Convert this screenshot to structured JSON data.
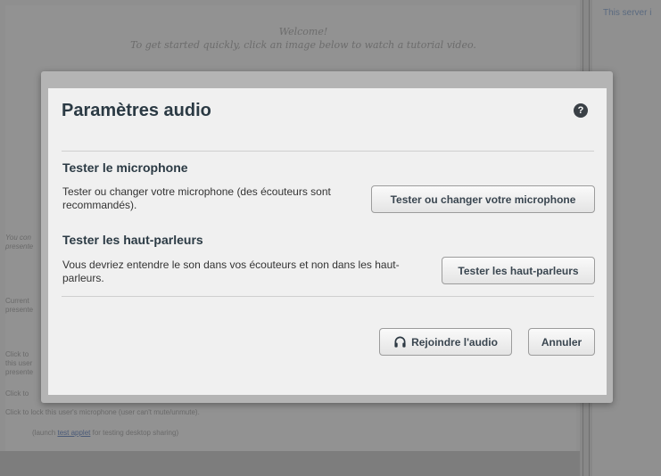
{
  "background": {
    "welcome_line1": "Welcome!",
    "welcome_line2": "To get started quickly, click an image below to watch a tutorial video.",
    "right_panel_text": "This server i",
    "side_notes": {
      "note1": "You con",
      "note1b": "presente",
      "note2": "Current",
      "note2b": "presente",
      "note3": "Click to",
      "note3b": "this user",
      "note3c": "presente",
      "note4": "Click to"
    },
    "lock_text": "Click to lock this user's microphone (user can't mute/unmute).",
    "applet_prefix": "(launch ",
    "applet_link": "test applet",
    "applet_suffix": " for testing desktop sharing)"
  },
  "dialog": {
    "title": "Paramètres audio",
    "help_symbol": "?",
    "microphone": {
      "heading": "Tester le microphone",
      "description": "Tester ou changer votre microphone (des écouteurs sont recommandés).",
      "button": "Tester ou changer votre microphone"
    },
    "speakers": {
      "heading": "Tester les haut-parleurs",
      "description": "Vous devriez entendre le son dans vos écouteurs et non dans les haut-parleurs.",
      "button": "Tester les haut-parleurs"
    },
    "join_button": "Rejoindre l'audio",
    "cancel_button": "Annuler"
  }
}
